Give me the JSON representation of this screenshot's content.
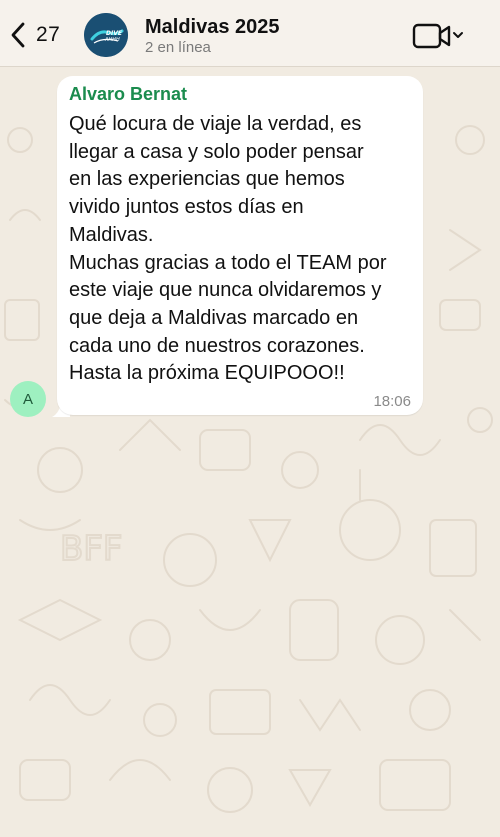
{
  "header": {
    "back_count": "27",
    "title": "Maldivas 2025",
    "subtitle": "2 en línea",
    "avatar_logo_text": "DIVE AHHH"
  },
  "message": {
    "avatar_initial": "A",
    "sender": "Alvaro Bernat",
    "text": "Qué locura de viaje la verdad, es\nllegar a casa y solo poder pensar\nen las experiencias que hemos\nvivido juntos estos días en\nMaldivas.\nMuchas gracias a todo el TEAM por\neste viaje que nunca olvidaremos y\nque deja a Maldivas marcado en\ncada uno de nuestros corazones.\nHasta la próxima EQUIPOOO!!",
    "time": "18:06"
  },
  "icons": {
    "back": "chevron-left-icon",
    "video": "video-camera-icon",
    "dropdown": "chevron-down-icon"
  },
  "colors": {
    "sender_name": "#1b8c4e",
    "avatar_bg": "#9ef0c0",
    "wallpaper": "#f1ebe1",
    "bubble": "#ffffff"
  }
}
